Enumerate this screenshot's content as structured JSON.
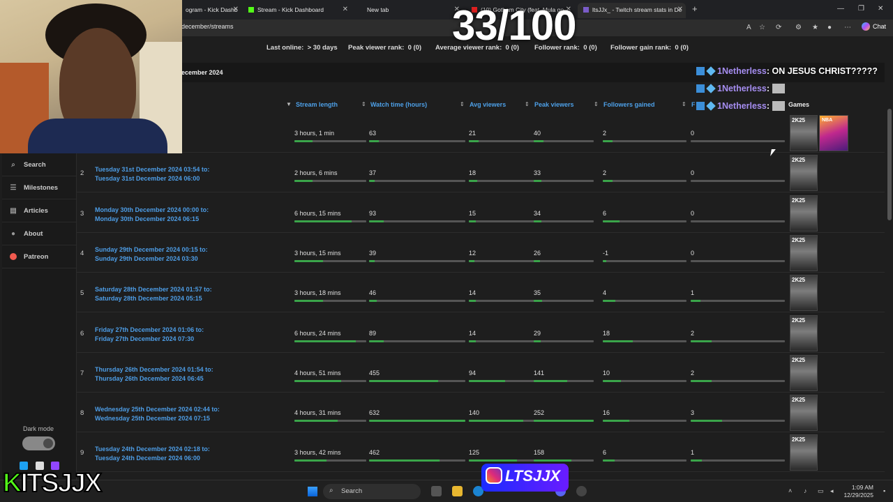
{
  "browser": {
    "tabs": [
      {
        "label": "ogram - Kick Dashb"
      },
      {
        "label": "Stream - Kick Dashboard"
      },
      {
        "label": "New tab"
      },
      {
        "label": "(10) Gotham City (feat. Mula go"
      },
      {
        "label": "ltsJJx_ - Twitch stream stats in De"
      }
    ],
    "url": "december/streams",
    "chat_label": "Chat"
  },
  "overlay": {
    "counter": "33/100",
    "chat": [
      {
        "user": "1Netherless",
        "sep": ":",
        "msg": "ON JESUS CHRIST?????"
      },
      {
        "user": "1Netherless",
        "sep": ":",
        "msg": ""
      },
      {
        "user": "1Netherless",
        "sep": ":",
        "msg": ""
      }
    ],
    "kick_logo_k": "K",
    "kick_logo_rest": "ITSJJX",
    "ig_handle": "LTSJJX"
  },
  "stats": {
    "last_online_label": "Last online:",
    "last_online_value": "> 30 days",
    "peak_rank_label": "Peak viewer rank:",
    "peak_rank_value": "0 (0)",
    "avg_rank_label": "Average viewer rank:",
    "avg_rank_value": "0 (0)",
    "follower_rank_label": "Follower rank:",
    "follower_rank_value": "0 (0)",
    "gain_rank_label": "Follower gain rank:",
    "gain_rank_value": "0 (0)"
  },
  "month_title": "ecember 2024",
  "sidebar": {
    "items": [
      {
        "label": "Search",
        "icon": "search-icon"
      },
      {
        "label": "Milestones",
        "icon": "list-icon"
      },
      {
        "label": "Articles",
        "icon": "article-icon"
      },
      {
        "label": "About",
        "icon": "info-icon"
      },
      {
        "label": "Patreon",
        "icon": "patreon-icon"
      }
    ],
    "dark_mode_label": "Dark mode"
  },
  "table": {
    "headers": {
      "stream_length": "Stream length",
      "watch_time": "Watch time (hours)",
      "avg_viewers": "Avg viewers",
      "peak_viewers": "Peak viewers",
      "followers_gained": "Followers gained",
      "followers_per_hour": "F",
      "games": "Games"
    },
    "rows": [
      {
        "num": "",
        "date1": "4 21:44 to:",
        "date2": "5 00:45",
        "length": "3 hours, 1 min",
        "watch": "63",
        "avg": "21",
        "peak": "40",
        "fol": "2",
        "fph": "0",
        "p": [
          0.25,
          0.1,
          0.15,
          0.16,
          0.12,
          0
        ],
        "second_game": true
      },
      {
        "num": "2",
        "date1": "Tuesday 31st December 2024 03:54 to:",
        "date2": "Tuesday 31st December 2024 06:00",
        "length": "2 hours, 6 mins",
        "watch": "37",
        "avg": "18",
        "peak": "33",
        "fol": "2",
        "fph": "0",
        "p": [
          0.25,
          0.06,
          0.13,
          0.13,
          0.12,
          0
        ],
        "second_game": false
      },
      {
        "num": "3",
        "date1": "Monday 30th December 2024 00:00 to:",
        "date2": "Monday 30th December 2024 06:15",
        "length": "6 hours, 15 mins",
        "watch": "93",
        "avg": "15",
        "peak": "34",
        "fol": "6",
        "fph": "0",
        "p": [
          0.8,
          0.15,
          0.11,
          0.13,
          0.2,
          0
        ],
        "second_game": false
      },
      {
        "num": "4",
        "date1": "Sunday 29th December 2024 00:15 to:",
        "date2": "Sunday 29th December 2024 03:30",
        "length": "3 hours, 15 mins",
        "watch": "39",
        "avg": "12",
        "peak": "26",
        "fol": "-1",
        "fph": "0",
        "p": [
          0.4,
          0.06,
          0.08,
          0.1,
          0.04,
          0
        ],
        "second_game": false
      },
      {
        "num": "5",
        "date1": "Saturday 28th December 2024 01:57 to:",
        "date2": "Saturday 28th December 2024 05:15",
        "length": "3 hours, 18 mins",
        "watch": "46",
        "avg": "14",
        "peak": "35",
        "fol": "4",
        "fph": "1",
        "p": [
          0.4,
          0.08,
          0.1,
          0.14,
          0.15,
          0.1
        ],
        "second_game": false
      },
      {
        "num": "6",
        "date1": "Friday 27th December 2024 01:06 to:",
        "date2": "Friday 27th December 2024 07:30",
        "length": "6 hours, 24 mins",
        "watch": "89",
        "avg": "14",
        "peak": "29",
        "fol": "18",
        "fph": "2",
        "p": [
          0.85,
          0.15,
          0.1,
          0.12,
          0.36,
          0.22
        ],
        "second_game": false
      },
      {
        "num": "7",
        "date1": "Thursday 26th December 2024 01:54 to:",
        "date2": "Thursday 26th December 2024 06:45",
        "length": "4 hours, 51 mins",
        "watch": "455",
        "avg": "94",
        "peak": "141",
        "fol": "10",
        "fph": "2",
        "p": [
          0.65,
          0.72,
          0.55,
          0.56,
          0.22,
          0.22
        ],
        "second_game": false
      },
      {
        "num": "8",
        "date1": "Wednesday 25th December 2024 02:44 to:",
        "date2": "Wednesday 25th December 2024 07:15",
        "length": "4 hours, 31 mins",
        "watch": "632",
        "avg": "140",
        "peak": "252",
        "fol": "16",
        "fph": "3",
        "p": [
          0.6,
          1.0,
          0.82,
          1.0,
          0.32,
          0.33
        ],
        "second_game": false
      },
      {
        "num": "9",
        "date1": "Tuesday 24th December 2024 02:18 to:",
        "date2": "Tuesday 24th December 2024 06:00",
        "length": "3 hours, 42 mins",
        "watch": "462",
        "avg": "125",
        "peak": "158",
        "fol": "6",
        "fph": "1",
        "p": [
          0.45,
          0.73,
          0.73,
          0.63,
          0.14,
          0.12
        ],
        "second_game": false
      }
    ],
    "game_badge": "2K25",
    "game2_badge": "NBA"
  },
  "taskbar": {
    "search_label": "Search",
    "time": "1:09 AM",
    "date": "12/29/2025"
  }
}
